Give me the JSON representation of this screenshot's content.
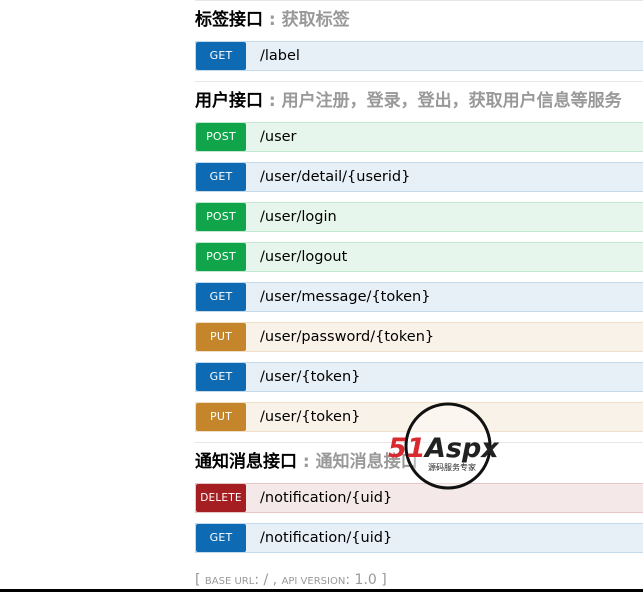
{
  "sections": [
    {
      "title": "标签接口",
      "separator": " : ",
      "description": "获取标签",
      "endpoints": [
        {
          "method": "GET",
          "path": "/label"
        }
      ]
    },
    {
      "title": "用户接口",
      "separator": " : ",
      "description": "用户注册，登录，登出，获取用户信息等服务",
      "endpoints": [
        {
          "method": "POST",
          "path": "/user"
        },
        {
          "method": "GET",
          "path": "/user/detail/{userid}"
        },
        {
          "method": "POST",
          "path": "/user/login"
        },
        {
          "method": "POST",
          "path": "/user/logout"
        },
        {
          "method": "GET",
          "path": "/user/message/{token}"
        },
        {
          "method": "PUT",
          "path": "/user/password/{token}"
        },
        {
          "method": "GET",
          "path": "/user/{token}"
        },
        {
          "method": "PUT",
          "path": "/user/{token}"
        }
      ]
    },
    {
      "title": "通知消息接口",
      "separator": " : ",
      "description": "通知消息接口",
      "endpoints": [
        {
          "method": "DELETE",
          "path": "/notification/{uid}"
        },
        {
          "method": "GET",
          "path": "/notification/{uid}"
        }
      ]
    }
  ],
  "footer": {
    "open": "[ ",
    "base_url_label": "base url",
    "base_url_sep": ": ",
    "base_url_value": "/",
    "comma": " , ",
    "api_version_label": "api version",
    "api_version_sep": ": ",
    "api_version_value": "1.0",
    "close": " ]"
  },
  "watermark": {
    "brand": "51Aspx",
    "tagline": "源码服务专家"
  },
  "colors": {
    "get": "#0f6ab4",
    "post": "#10a54a",
    "put": "#c5862b",
    "delete": "#a41e22"
  }
}
